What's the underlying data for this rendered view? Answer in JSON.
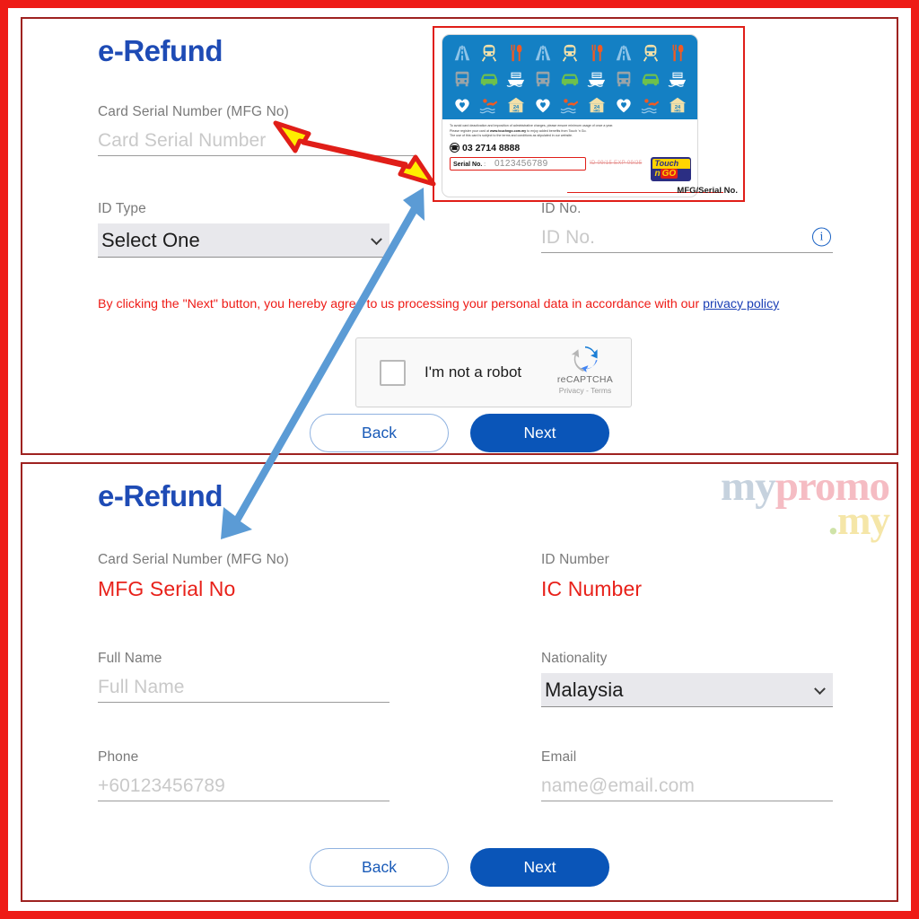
{
  "page": {
    "title_top": "e-Refund",
    "title_bottom": "e-Refund"
  },
  "form_top": {
    "card_serial": {
      "label": "Card Serial Number (MFG No)",
      "placeholder": "Card Serial Number"
    },
    "id_type": {
      "label": "ID Type",
      "value": "Select One"
    },
    "id_no": {
      "label": "ID No.",
      "placeholder": "ID No.",
      "info_glyph": "i"
    },
    "consent": {
      "text": "By clicking the \"Next\" button, you hereby agree to us processing your personal data in accordance with our ",
      "link": "privacy policy"
    },
    "recaptcha": {
      "checkbox_label": "I'm not a robot",
      "brand": "reCAPTCHA",
      "terms": "Privacy - Terms"
    },
    "buttons": {
      "back": "Back",
      "next": "Next"
    }
  },
  "form_bottom": {
    "card_serial": {
      "label": "Card Serial Number (MFG No)",
      "value": "MFG Serial No"
    },
    "id_number": {
      "label": "ID Number",
      "value": "IC Number"
    },
    "full_name": {
      "label": "Full Name",
      "placeholder": "Full Name"
    },
    "nationality": {
      "label": "Nationality",
      "value": "Malaysia"
    },
    "phone": {
      "label": "Phone",
      "placeholder": "+60123456789"
    },
    "email": {
      "label": "Email",
      "placeholder": "name@email.com"
    },
    "buttons": {
      "back": "Back",
      "next": "Next"
    }
  },
  "card": {
    "fineprint_line1": "To avoid card deactivation and imposition of administrative charges, please ensure minimum usage of once a year.",
    "fineprint_line2_a": "Please register your card at ",
    "fineprint_line2_b": "www.touchngo.com.my",
    "fineprint_line2_c": " to enjoy added benefits from Touch 'n Go.",
    "fineprint_line3": "The use of this card is subject to the terms and conditions as stipulated in our website.",
    "phone": "03 2714 8888",
    "serial_label": "Serial No.",
    "serial_colon": ":",
    "serial_value": "0123456789",
    "serial_strike": "ID 09/15   EXP 09/25",
    "logo_line1": "Touch",
    "logo_line2_a": "n",
    "logo_line2_b": "GO",
    "mfg_callout": "MFG/Serial No."
  },
  "watermark": {
    "part1": "my",
    "part2": "promo",
    "dot": ".",
    "part3": "my"
  },
  "colors": {
    "frame_red": "#ee1b16",
    "panel_border": "#9e2220",
    "title_blue": "#1e4bb5",
    "consent_red": "#ee1b16",
    "link_blue": "#1a3fb5",
    "value_red": "#e8211a",
    "next_blue": "#0a55b8",
    "back_blue": "#1a5bb8",
    "card_blue": "#1480c4",
    "arrow_yellow": "#ffee00",
    "arrow_yellow_outline": "#e01e18",
    "arrow_blue": "#5b9bd5"
  }
}
